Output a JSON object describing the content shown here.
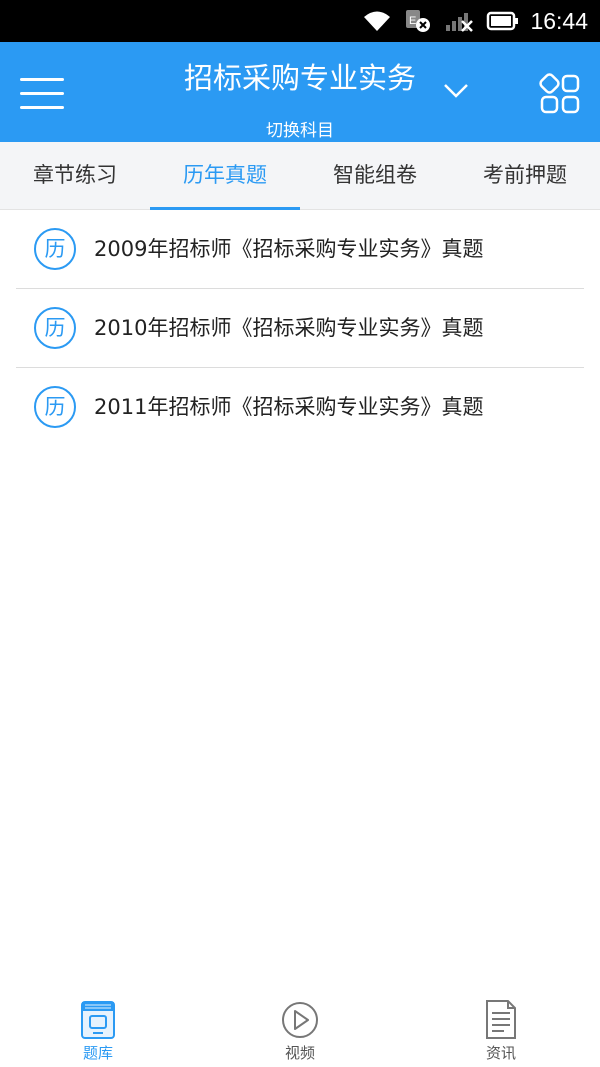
{
  "status_bar": {
    "time": "16:44",
    "icons": [
      "wifi-icon",
      "e-network-icon",
      "signal-icon",
      "battery-icon"
    ]
  },
  "header": {
    "title": "招标采购专业实务",
    "subtitle": "切换科目",
    "background": "#2b9af3",
    "icons": [
      "menu-icon",
      "chevron-down-icon",
      "apps-icon"
    ]
  },
  "tabs": [
    {
      "label": "章节练习",
      "active": false
    },
    {
      "label": "历年真题",
      "active": true
    },
    {
      "label": "智能组卷",
      "active": false
    },
    {
      "label": "考前押题",
      "active": false
    }
  ],
  "list": {
    "badge": "历",
    "items": [
      "2009年招标师《招标采购专业实务》真题",
      "2010年招标师《招标采购专业实务》真题",
      "2011年招标师《招标采购专业实务》真题"
    ]
  },
  "bottom_nav": [
    {
      "label": "题库",
      "icon": "question-bank-icon",
      "active": true
    },
    {
      "label": "视频",
      "icon": "play-icon",
      "active": false
    },
    {
      "label": "资讯",
      "icon": "document-icon",
      "active": false
    }
  ],
  "colors": {
    "accent": "#2b9af3",
    "text": "#222222",
    "tab_bg": "#f4f5f7"
  }
}
